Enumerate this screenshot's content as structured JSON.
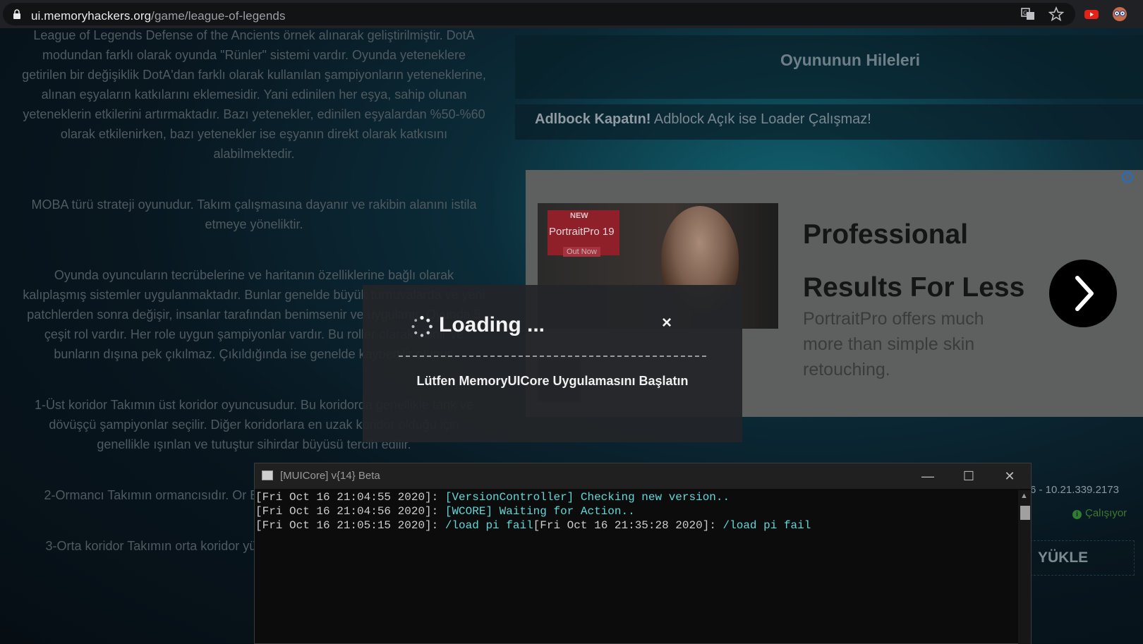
{
  "browser": {
    "url_host": "ui.memoryhackers.org",
    "url_path": "/game/league-of-legends",
    "icons": [
      "lock-icon",
      "translate-icon",
      "star-icon",
      "youtube-icon",
      "extension-icon"
    ]
  },
  "article": {
    "paragraphs": [
      "League of Legends Defense of the Ancients örnek alınarak geliştirilmiştir. DotA modundan farklı olarak oyunda \"Rünler\" sistemi vardır. Oyunda yeteneklere getirilen bir değişiklik DotA'dan farklı olarak kullanılan şampiyonların yeteneklerine, alınan eşyaların katkılarını eklemesidir. Yani edinilen her eşya, sahip olunan yeteneklerin etkilerini artırmaktadır. Bazı yetenekler, edinilen eşyalardan %50-%60 olarak etkilenirken, bazı yetenekler ise eşyanın direkt olarak katkısını alabilmektedir.",
      "MOBA türü strateji oyunudur. Takım çalışmasına dayanır ve rakibin alanını istila etmeye yöneliktir.",
      "Oyunda oyuncuların tecrübelerine ve haritanın özelliklerine bağlı olarak kalıplaşmış sistemler uygulanmaktadır. Bunlar genelde büyük turnuvalarda ve yeni patchlerden sonra değişir, insanlar tarafından benimsenir ve uygulanır. Oyunda 5 çeşit rol vardır. Her role uygun şampiyonlar vardır. Bu roller olarak bilinir ve bunların dışına pek çıkılmaz. Çıkıldığında ise genelde kaybedilir olunur.",
      "1-Üst koridor Takımın üst koridor oyuncusudur. Bu koridorda genellikle tank ve dövüşçü şampiyonlar seçilir. Diğer koridorlara en uzak koridor olduğu için genellikle ışınlan ve tutuştur sihirdar büyüsü tercih edilir.",
      "2-Ormancı Takımın ormancısıdır. Or Baskın potansiyeli yüksek, mobil, tank",
      "3-Orta koridor Takımın orta koridor yüklerine sahiplerdir. Genelde kontr edi"
    ]
  },
  "cheats": {
    "title": "Oyununun Hileleri",
    "notice_bold": "Adlbock Kapatın!",
    "notice_text": " Adblock Açık ise Loader Çalışmaz!"
  },
  "ad": {
    "badge_new": "NEW",
    "product": "PortraitPro 19",
    "badge_out": "Out Now",
    "headline": "Professional Results For Less",
    "subtext": "PortraitPro offers much more than simple skin retouching.",
    "info": "i"
  },
  "loader": {
    "version_text": "6 - 10.21.339.2173",
    "status_text": "Çalışıyor",
    "load_button": "YÜKLE"
  },
  "modal": {
    "title": "Loading ...",
    "close": "×",
    "message": "Lütfen MemoryUICore Uygulamasını Başlatın"
  },
  "console": {
    "title": "[MUICore] v{14} Beta",
    "minimize": "—",
    "maximize": "☐",
    "close": "✕",
    "lines": [
      {
        "time": "[Fri Oct 16 21:04:55 2020]: ",
        "msg": "[VersionController] Checking new version.."
      },
      {
        "time": "[Fri Oct 16 21:04:56 2020]: ",
        "msg": "[WCORE] Waiting for Action.."
      },
      {
        "time": "[Fri Oct 16 21:05:15 2020]: ",
        "msg": "/load pi fail",
        "time2": "[Fri Oct 16 21:35:28 2020]: ",
        "msg2": "/load pi fail"
      }
    ]
  },
  "colors": {
    "console_highlight": "#61d6d6",
    "status_green": "#2e7d32",
    "ad_badge": "#8f1f28"
  }
}
